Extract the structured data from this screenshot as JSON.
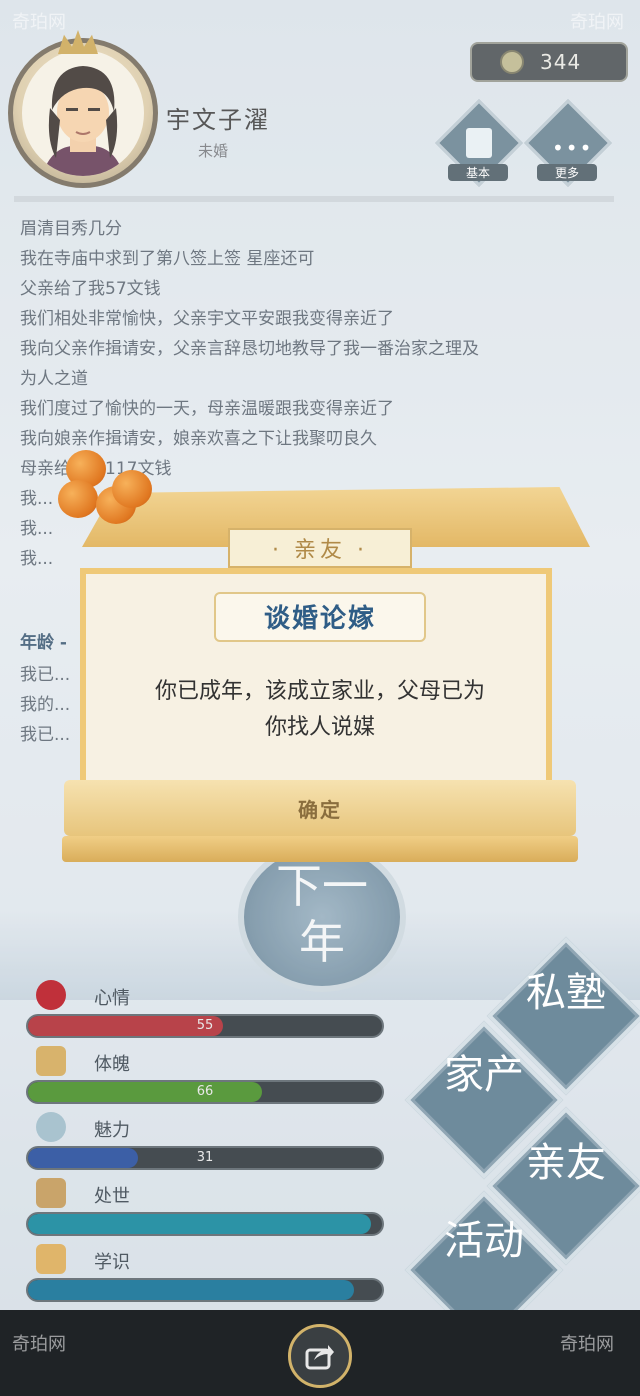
{
  "header": {
    "name": "宇文子濯",
    "subname": "未婚",
    "coins": "344",
    "buttons": [
      {
        "label": "基本",
        "icon": "book-icon"
      },
      {
        "label": "更多",
        "icon": "more-icon"
      }
    ]
  },
  "log": [
    "眉清目秀几分",
    "我在寺庙中求到了第八签上签 星座还可",
    "父亲给了我57文钱",
    "我们相处非常愉快，父亲宇文平安跟我变得亲近了",
    "我向父亲作揖请安，父亲言辞恳切地教导了我一番治家之理及",
    "为人之道",
    "我们度过了愉快的一天，母亲温暖跟我变得亲近了",
    "我向娘亲作揖请安，娘亲欢喜之下让我聚叨良久",
    "母亲给了我117文钱",
    "我...",
    "我...",
    "我..."
  ],
  "log2": [
    "年龄 -",
    "我已...",
    "我的...",
    "我已..."
  ],
  "dialog": {
    "tab_title": "亲友",
    "subtitle": "谈婚论嫁",
    "message_line1": "你已成年，该成立家业，父母已为",
    "message_line2": "你找人说媒",
    "confirm_label": "确定"
  },
  "next_year": {
    "line1": "下一",
    "line2": "年"
  },
  "stats": [
    {
      "label": "心情",
      "value": 55,
      "max": 100,
      "color": "#b8434a",
      "icon": "flower-icon"
    },
    {
      "label": "体魄",
      "value": 66,
      "max": 100,
      "color": "#5a9a3e",
      "icon": "muscle-icon"
    },
    {
      "label": "魅力",
      "value": 31,
      "max": 100,
      "color": "#3c5fa6",
      "icon": "orb-icon"
    },
    {
      "label": "处世",
      "value": null,
      "max": 100,
      "color": "#2c93a6",
      "icon": "handshake-icon"
    },
    {
      "label": "学识",
      "value": null,
      "max": 100,
      "color": "#2a7fa0",
      "icon": "scroll-icon"
    }
  ],
  "menu": [
    {
      "label": "私塾"
    },
    {
      "label": "家产"
    },
    {
      "label": "亲友"
    },
    {
      "label": "活动"
    }
  ],
  "watermark": "奇珀网"
}
